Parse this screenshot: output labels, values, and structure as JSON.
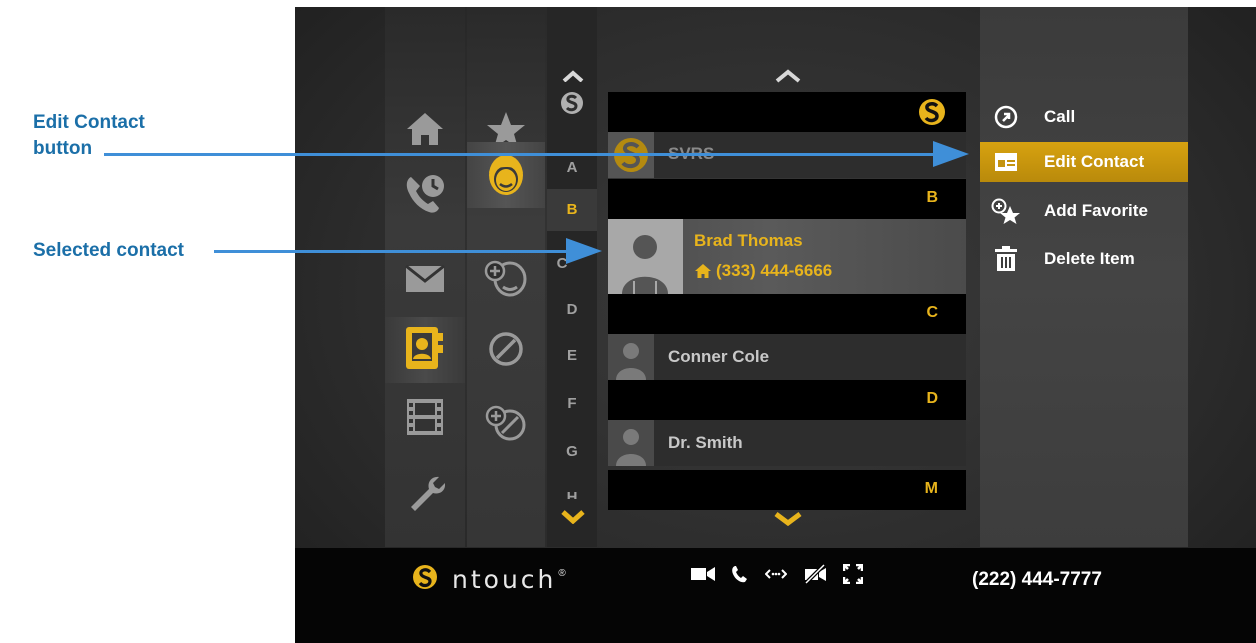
{
  "annotations": {
    "edit_contact_line1": "Edit Contact",
    "edit_contact_line2": "button",
    "selected_contact": "Selected contact"
  },
  "nav": {
    "main": [
      "home-icon",
      "call-history-icon",
      "mail-icon",
      "contacts-icon",
      "video-icon",
      "settings-icon"
    ],
    "sub": [
      "favorites-icon",
      "contacts-list-icon",
      "add-contact-icon",
      "block-icon",
      "add-block-icon"
    ],
    "active_main": "contacts-icon",
    "active_sub": "contacts-list-icon"
  },
  "alphabet": {
    "letters": [
      "A",
      "B",
      "C",
      "D",
      "E",
      "F",
      "G",
      "H"
    ],
    "active": "B"
  },
  "contacts": {
    "header_s": "S",
    "svrs_name": "SVRS",
    "header_b": "B",
    "selected_name": "Brad Thomas",
    "selected_phone": "(333) 444-6666",
    "header_c": "C",
    "conner_name": "Conner Cole",
    "header_d": "D",
    "smith_name": "Dr. Smith",
    "header_m": "M"
  },
  "menu": {
    "call": "Call",
    "edit_contact": "Edit Contact",
    "add_favorite": "Add Favorite",
    "delete_item": "Delete Item"
  },
  "bottombar": {
    "brand": "ntouch",
    "phone": "(222) 444-7777"
  },
  "colors": {
    "accent": "#e8b41c",
    "annotation": "#1b6fa8",
    "arrow": "#3f8fd8"
  }
}
